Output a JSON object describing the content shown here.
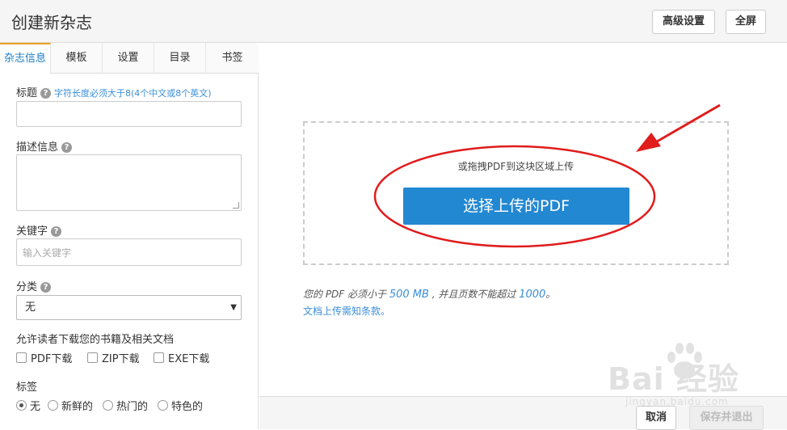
{
  "header": {
    "title": "创建新杂志",
    "advanced_label": "高级设置",
    "fullscreen_label": "全屏"
  },
  "tabs": [
    {
      "label": "杂志信息"
    },
    {
      "label": "模板"
    },
    {
      "label": "设置"
    },
    {
      "label": "目录"
    },
    {
      "label": "书签"
    }
  ],
  "form": {
    "title_label": "标题",
    "title_hint": "字符长度必须大于8(4个中文或8个英文)",
    "desc_label": "描述信息",
    "keyword_label": "关键字",
    "keyword_placeholder": "输入关键字",
    "category_label": "分类",
    "category_value": "无",
    "download_label": "允许读者下载您的书籍及相关文档",
    "download_options": [
      "PDF下载",
      "ZIP下载",
      "EXE下载"
    ],
    "tag_label": "标签",
    "tag_options": [
      "无",
      "新鲜的",
      "热门的",
      "特色的"
    ],
    "tag_selected": "无"
  },
  "upload": {
    "drag_text": "或拖拽PDF到这块区域上传",
    "button_label": "选择上传的PDF",
    "note_prefix": "您的 PDF 必须小于 ",
    "size_limit": "500 MB",
    "note_middle": " , 并且页数不能超过 ",
    "page_limit": "1000",
    "note_suffix": "。",
    "terms_link": "文档上传需知条款。"
  },
  "footer": {
    "cancel_label": "取消",
    "save_label": "保存并退出"
  },
  "watermark": {
    "logo": "Bai 经验",
    "sub": "jingyan.baidu.com"
  },
  "colors": {
    "accent": "#2388d2",
    "link": "#3a8fd8",
    "annotation": "#e01c1c",
    "tab_highlight": "#f0a020"
  }
}
